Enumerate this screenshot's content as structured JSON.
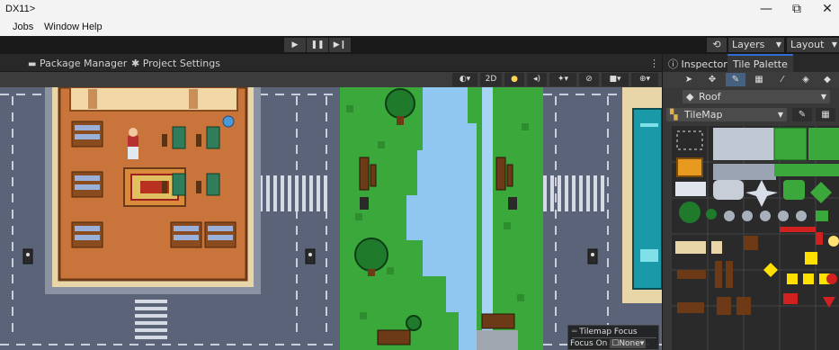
{
  "window": {
    "title": "DX11>",
    "minimize_glyph": "—",
    "maximize_glyph": "⧉",
    "close_glyph": "✕"
  },
  "menu": [
    "Jobs",
    "Window",
    "Help"
  ],
  "toolbar": {
    "play_glyph": "▶",
    "pause_glyph": "❚❚",
    "step_glyph": "▶❙",
    "history_glyph": "⟲",
    "search_glyph": "⚲",
    "layers_label": "Layers",
    "layout_label": "Layout"
  },
  "tabs": {
    "package_manager": "Package Manager",
    "project_settings": "Project Settings",
    "more_glyph": "⋮"
  },
  "scene_toolbar": {
    "mode_2d": "2D",
    "arrow": "▾"
  },
  "tilemap_focus": {
    "title": "Tilemap Focus",
    "focus_on_label": "Focus On",
    "focus_value": "None"
  },
  "right_pane": {
    "inspector_tab": "Inspector",
    "tile_palette_tab": "Tile Palette",
    "palette_name": "Roof",
    "target_tilemap": "TileMap"
  },
  "colors": {
    "grass": "#3aa83a",
    "water": "#8fc7f0",
    "road": "#5a6378",
    "floor": "#c8743a",
    "accent": "#2e6fd6"
  }
}
